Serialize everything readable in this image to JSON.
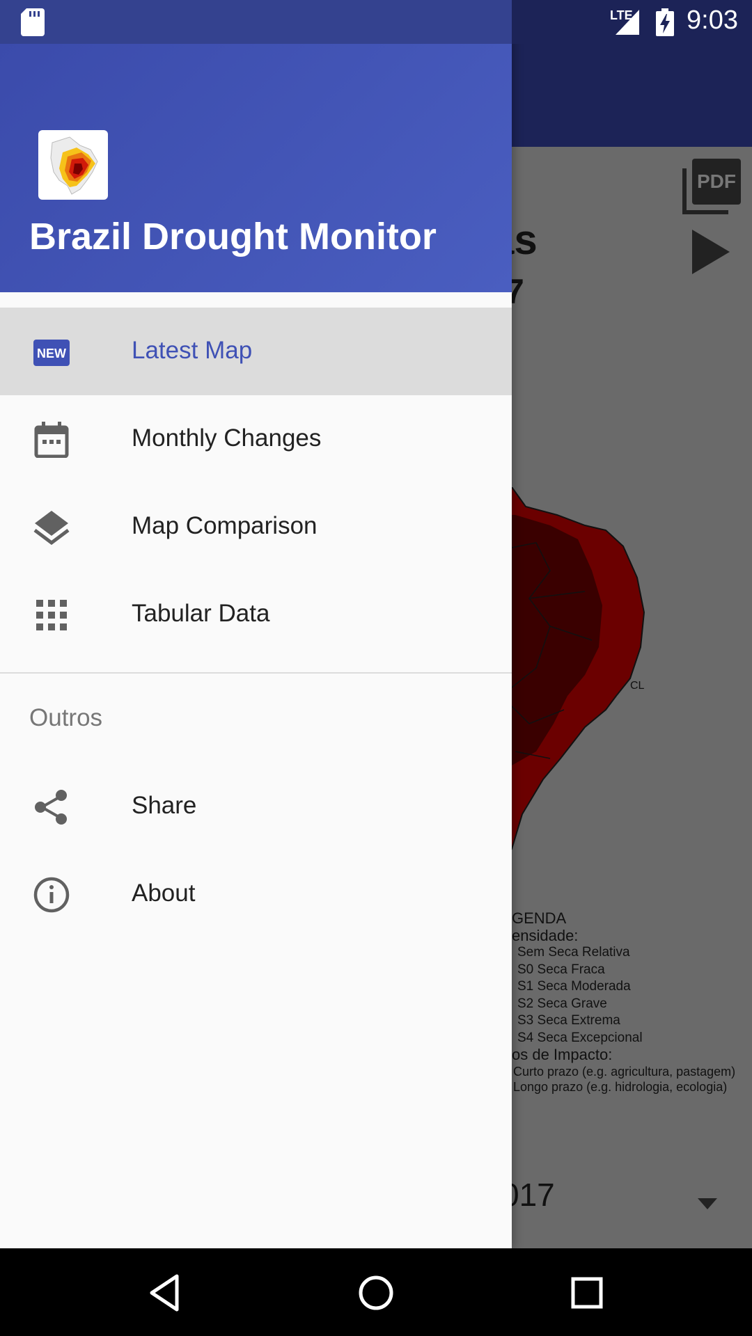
{
  "status_bar": {
    "network": "LTE",
    "time": "9:03"
  },
  "background": {
    "title_fragment_1": "as",
    "title_fragment_2": "7",
    "legend": {
      "heading": "GENDA",
      "intensity_label": "ensidade:",
      "items": [
        "Sem Seca Relativa",
        "S0 Seca Fraca",
        "S1 Seca Moderada",
        "S2 Seca Grave",
        "S3 Seca Extrema",
        "S4 Seca Excepcional"
      ],
      "impact_label": "os de Impacto:",
      "impact_items": [
        ": Curto prazo (e.g. agricultura, pastagem)",
        ": Longo prazo (e.g. hidrologia, ecologia)"
      ]
    },
    "year_fragment": "017",
    "map_label": "CL"
  },
  "drawer": {
    "app_name": "Brazil Drought Monitor",
    "menu": [
      {
        "label": "Latest Map",
        "icon": "new-badge-icon",
        "active": true
      },
      {
        "label": "Monthly Changes",
        "icon": "calendar-icon",
        "active": false
      },
      {
        "label": "Map Comparison",
        "icon": "layers-icon",
        "active": false
      },
      {
        "label": "Tabular Data",
        "icon": "grid-icon",
        "active": false
      }
    ],
    "section_title": "Outros",
    "secondary_menu": [
      {
        "label": "Share",
        "icon": "share-icon"
      },
      {
        "label": "About",
        "icon": "info-icon"
      }
    ]
  },
  "colors": {
    "primary": "#3f51b5",
    "header_gradient_start": "#3b4bab",
    "status_bar": "#34428f",
    "active_item_bg": "#dcdcdc"
  }
}
